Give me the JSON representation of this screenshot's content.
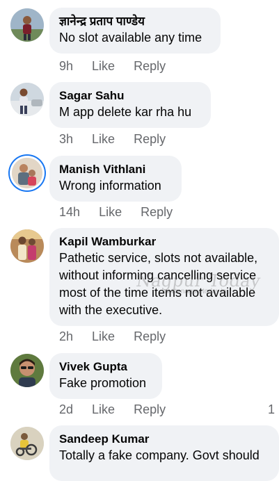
{
  "comments": [
    {
      "author": "ज्ञानेन्द्र प्रताप पाण्डेय",
      "text": "No slot available any time",
      "time": "9h",
      "like_label": "Like",
      "reply_label": "Reply"
    },
    {
      "author": "Sagar Sahu",
      "text": "M app delete kar rha hu",
      "time": "3h",
      "like_label": "Like",
      "reply_label": "Reply"
    },
    {
      "author": "Manish Vithlani",
      "text": "Wrong information",
      "time": "14h",
      "like_label": "Like",
      "reply_label": "Reply"
    },
    {
      "author": "Kapil Wamburkar",
      "text": "Pathetic service, slots not available, without informing cancelling service most of the time items not available with the executive.",
      "time": "2h",
      "like_label": "Like",
      "reply_label": "Reply"
    },
    {
      "author": "Vivek Gupta",
      "text": "Fake promotion",
      "time": "2d",
      "like_label": "Like",
      "reply_label": "Reply",
      "reaction_count": "1"
    },
    {
      "author": "Sandeep Kumar",
      "text": "Totally a fake company. Govt should"
    }
  ],
  "watermark": {
    "title": "Nagpur Today",
    "url": "www.nagpurtoday.in"
  },
  "colors": {
    "bubble": "#f0f2f5",
    "meta_text": "#65676b",
    "story_ring": "#1877f2"
  }
}
